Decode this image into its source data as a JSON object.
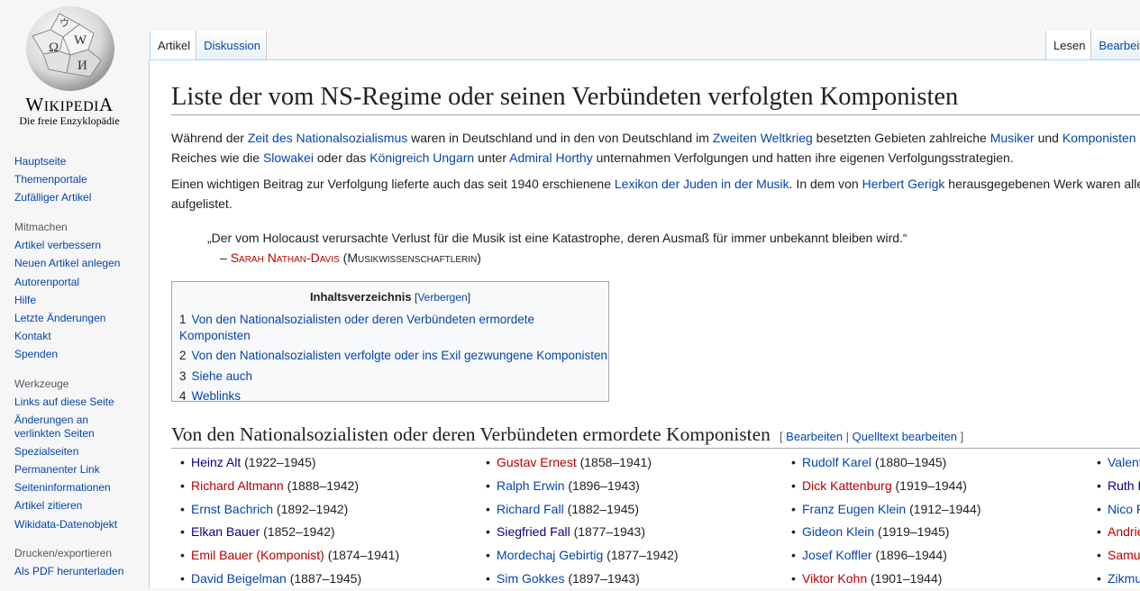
{
  "logo": {
    "wordmark_first": "W",
    "wordmark_rest": "IKIPEDI",
    "wordmark_last": "A",
    "tagline": "Die freie Enzyklopädie"
  },
  "sidebar": {
    "nav": [
      "Hauptseite",
      "Themenportale",
      "Zufälliger Artikel"
    ],
    "mitmachen": {
      "heading": "Mitmachen",
      "items": [
        "Artikel verbessern",
        "Neuen Artikel anlegen",
        "Autorenportal",
        "Hilfe",
        "Letzte Änderungen",
        "Kontakt",
        "Spenden"
      ]
    },
    "werkzeuge": {
      "heading": "Werkzeuge",
      "items": [
        "Links auf diese Seite",
        "Änderungen an verlinkten Seiten",
        "Spezialseiten",
        "Permanenter Link",
        "Seiteninformationen",
        "Artikel zitieren",
        "Wikidata-Datenobjekt"
      ]
    },
    "drucken": {
      "heading": "Drucken/exportieren",
      "items": [
        "Als PDF herunterladen"
      ]
    }
  },
  "tabs": {
    "left": [
      "Artikel",
      "Diskussion"
    ],
    "right": [
      "Lesen",
      "Bearbeiten"
    ]
  },
  "article": {
    "title": "Liste der vom NS-Regime oder seinen Verbündeten verfolgten Komponisten",
    "p1_line1": [
      {
        "t": "Während der "
      },
      {
        "t": "Zeit des Nationalsozialismus",
        "l": 1
      },
      {
        "t": " waren in Deutschland und in den von Deutschland im "
      },
      {
        "t": "Zweiten Weltkrieg",
        "l": 1
      },
      {
        "t": " besetzten Gebieten zahlreiche "
      },
      {
        "t": "Musiker",
        "l": 1
      },
      {
        "t": " und "
      },
      {
        "t": "Komponisten",
        "l": 1
      },
      {
        "t": " ("
      }
    ],
    "p1_line2": [
      {
        "t": "Reiches wie die "
      },
      {
        "t": "Slowakei",
        "l": 1
      },
      {
        "t": " oder das "
      },
      {
        "t": "Königreich Ungarn",
        "l": 1
      },
      {
        "t": " unter "
      },
      {
        "t": "Admiral Horthy",
        "l": 1
      },
      {
        "t": " unternahmen Verfolgungen und hatten ihre eigenen Verfolgungsstrategien."
      }
    ],
    "p2_line1": [
      {
        "t": "Einen wichtigen Beitrag zur Verfolgung lieferte auch das seit 1940 erschienene "
      },
      {
        "t": "Lexikon der Juden in der Musik",
        "l": 1
      },
      {
        "t": ". In dem von "
      },
      {
        "t": "Herbert Gerigk",
        "l": 1
      },
      {
        "t": " herausgegebenen Werk waren alle"
      }
    ],
    "p2_line2": "aufgelistet.",
    "quote_text": "„Der vom Holocaust verursachte Verlust für die Musik ist eine Katastrophe, deren Ausmaß für immer unbekannt bleiben wird.“",
    "quote_dash": "– ",
    "quote_author": "Sarah Nathan-Davis",
    "quote_role": " (Musikwissenschaftlerin)"
  },
  "toc": {
    "title": "Inhaltsverzeichnis",
    "toggle_open": " [",
    "toggle": "Verbergen",
    "toggle_close": "]",
    "items": [
      {
        "num": "1",
        "label": "Von den Nationalsozialisten oder deren Verbündeten ermordete Komponisten"
      },
      {
        "num": "2",
        "label": "Von den Nationalsozialisten verfolgte oder ins Exil gezwungene Komponisten"
      },
      {
        "num": "3",
        "label": "Siehe auch"
      },
      {
        "num": "4",
        "label": "Weblinks"
      }
    ]
  },
  "section": {
    "title": "Von den Nationalsozialisten oder deren Verbündeten ermordete Komponisten",
    "edit_open": "[ ",
    "edit": "Bearbeiten",
    "sep": " | ",
    "edit_source": "Quelltext bearbeiten",
    "edit_close": " ]"
  },
  "composers": [
    [
      {
        "name": "Heinz Alt",
        "years": " (1922–1945)",
        "c": "visited"
      },
      {
        "name": "Richard Altmann",
        "years": " (1888–1942)",
        "c": "red"
      },
      {
        "name": "Ernst Bachrich",
        "years": " (1892–1942)",
        "c": "blue"
      },
      {
        "name": "Elkan Bauer",
        "years": " (1852–1942)",
        "c": "visited"
      },
      {
        "name": "Emil Bauer (Komponist)",
        "years": " (1874–1941)",
        "c": "red"
      },
      {
        "name": "David Beigelman",
        "years": " (1887–1945)",
        "c": "blue"
      }
    ],
    [
      {
        "name": "Gustav Ernest",
        "years": " (1858–1941)",
        "c": "red"
      },
      {
        "name": "Ralph Erwin",
        "years": " (1896–1943)",
        "c": "blue"
      },
      {
        "name": "Richard Fall",
        "years": " (1882–1945)",
        "c": "blue"
      },
      {
        "name": "Siegfried Fall",
        "years": " (1877–1943)",
        "c": "visited"
      },
      {
        "name": "Mordechaj Gebirtig",
        "years": " (1877–1942)",
        "c": "blue"
      },
      {
        "name": "Sim Gokkes",
        "years": " (1897–1943)",
        "c": "blue"
      }
    ],
    [
      {
        "name": "Rudolf Karel",
        "years": " (1880–1945)",
        "c": "blue"
      },
      {
        "name": "Dick Kattenburg",
        "years": " (1919–1944)",
        "c": "red"
      },
      {
        "name": "Franz Eugen Klein",
        "years": " (1912–1944)",
        "c": "blue"
      },
      {
        "name": "Gideon Klein",
        "years": " (1919–1945)",
        "c": "blue"
      },
      {
        "name": "Josef Koffler",
        "years": " (1896–1944)",
        "c": "blue"
      },
      {
        "name": "Viktor Kohn",
        "years": " (1901–1944)",
        "c": "red"
      }
    ],
    [
      {
        "name": "Valent",
        "years": "",
        "c": "blue"
      },
      {
        "name": "Ruth H",
        "years": "",
        "c": "visited"
      },
      {
        "name": "Nico F",
        "years": "",
        "c": "blue"
      },
      {
        "name": "Andrie",
        "years": "",
        "c": "red"
      },
      {
        "name": "Samu",
        "years": "",
        "c": "red"
      },
      {
        "name": "Zikmu",
        "years": "",
        "c": "blue"
      }
    ]
  ]
}
